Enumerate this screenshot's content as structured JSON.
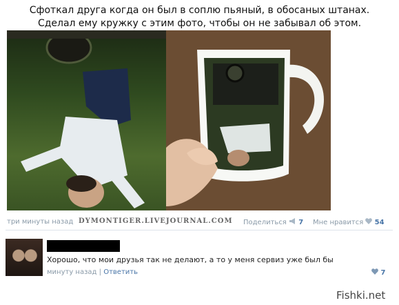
{
  "post": {
    "caption_line1": "Сфоткал друга когда он был в соплю пьяный, в обосаных штанах.",
    "caption_line2": "Сделал ему кружку с этим фото, чтобы он не забывал об этом.",
    "time": "три минуты назад",
    "watermark": "DYMONTIGER.LIVEJOURNAL.COM",
    "share_label": "Поделиться",
    "share_count": "7",
    "like_label": "Мне нравится",
    "like_count": "54"
  },
  "comment": {
    "text": "Хорошо, что мои друзья так не делают, а то у меня сервиз уже был бы",
    "time": "минуту назад",
    "separator": "|",
    "reply_label": "Ответить",
    "like_count": "7"
  },
  "site": {
    "mark": "Fishki.net"
  },
  "colors": {
    "link": "#4a76a8",
    "muted": "#8a9aa8"
  }
}
